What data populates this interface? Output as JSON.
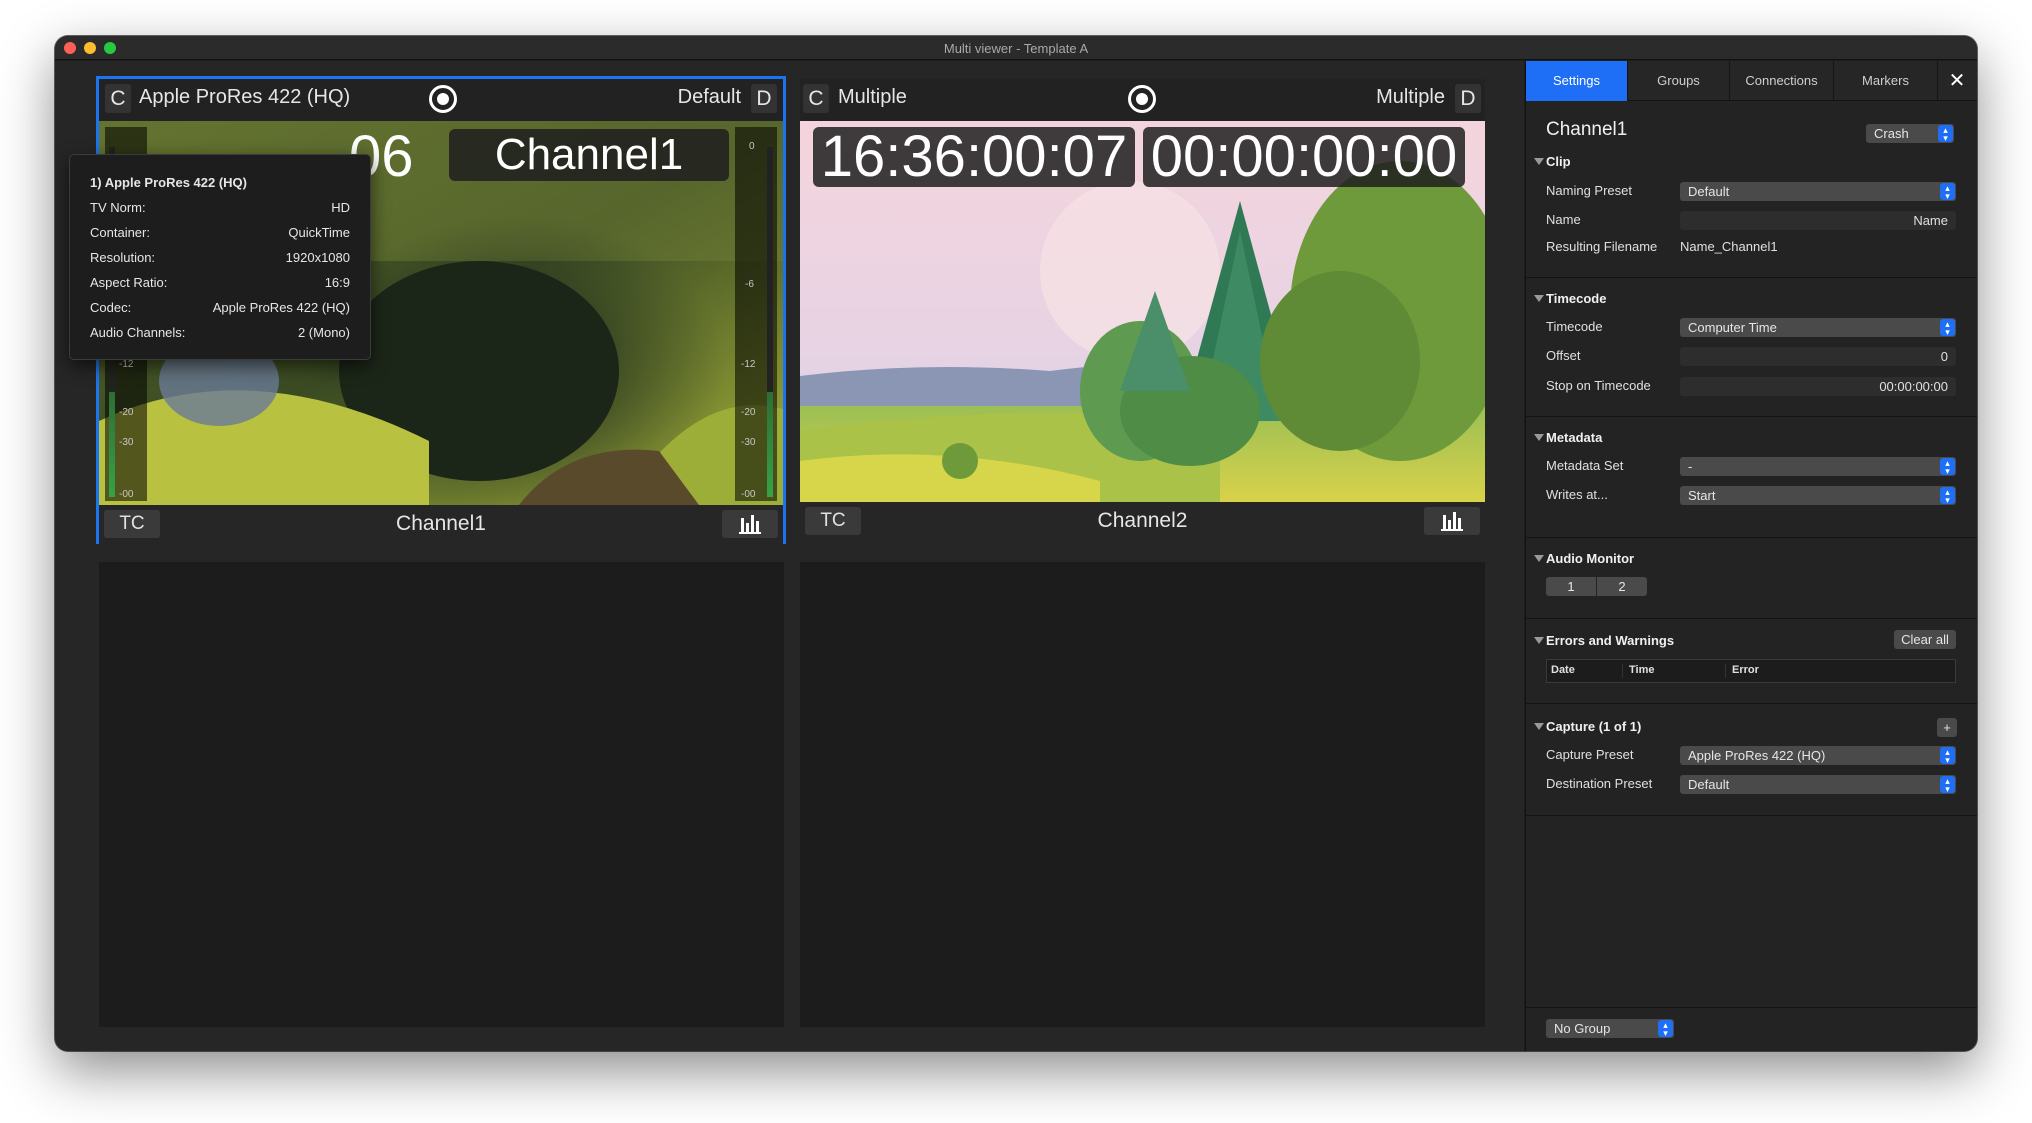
{
  "window": {
    "title": "Multi viewer - Template A"
  },
  "viewports": [
    {
      "format": "Apple ProRes 422 (HQ)",
      "c_label": "C",
      "preset": "Default",
      "d_label": "D",
      "timecode_left": "06",
      "timecode_right": "Channel1",
      "tc_button": "TC",
      "channel": "Channel1",
      "selected": true
    },
    {
      "format": "Multiple",
      "c_label": "C",
      "preset": "Multiple",
      "d_label": "D",
      "timecode_left": "16:36:00:07",
      "timecode_right": "00:00:00:00",
      "tc_button": "TC",
      "channel": "Channel2",
      "selected": false
    }
  ],
  "meter_ticks": {
    "left": [
      "-12",
      "-20",
      "-30",
      "-00"
    ],
    "right": [
      "0",
      "-6",
      "-12",
      "-20",
      "-30",
      "-00"
    ]
  },
  "tooltip": {
    "title": "1) Apple ProRes 422 (HQ)",
    "rows": [
      {
        "key": "TV Norm:",
        "value": "HD"
      },
      {
        "key": "Container:",
        "value": "QuickTime"
      },
      {
        "key": "Resolution:",
        "value": "1920x1080"
      },
      {
        "key": "Aspect Ratio:",
        "value": "16:9"
      },
      {
        "key": "Codec:",
        "value": "Apple ProRes 422 (HQ)"
      },
      {
        "key": "Audio Channels:",
        "value": "2 (Mono)"
      }
    ]
  },
  "sidebar": {
    "tabs": [
      "Settings",
      "Groups",
      "Connections",
      "Markers"
    ],
    "close": "✕",
    "channel_title": "Channel1",
    "crash_select": "Crash",
    "clip": {
      "title": "Clip",
      "naming_preset_label": "Naming Preset",
      "naming_preset_value": "Default",
      "name_label": "Name",
      "name_value": "Name",
      "resulting_filename_label": "Resulting Filename",
      "resulting_filename_value": "Name_Channel1"
    },
    "timecode": {
      "title": "Timecode",
      "timecode_label": "Timecode",
      "timecode_value": "Computer Time",
      "offset_label": "Offset",
      "offset_value": "0",
      "stop_label": "Stop on Timecode",
      "stop_value": "00:00:00:00"
    },
    "metadata": {
      "title": "Metadata",
      "set_label": "Metadata Set",
      "set_value": "-",
      "writes_label": "Writes at...",
      "writes_value": "Start"
    },
    "audio_monitor": {
      "title": "Audio Monitor",
      "channels": [
        "1",
        "2"
      ]
    },
    "errors": {
      "title": "Errors and Warnings",
      "clear_all": "Clear all",
      "columns": [
        "Date",
        "Time",
        "Error"
      ]
    },
    "capture": {
      "title": "Capture (1 of 1)",
      "add": "+",
      "capture_preset_label": "Capture Preset",
      "capture_preset_value": "Apple ProRes 422 (HQ)",
      "destination_label": "Destination Preset",
      "destination_value": "Default"
    },
    "group_select": "No Group"
  },
  "colors": {
    "accent": "#1e6ff5",
    "selection_border": "#1b74f0"
  }
}
